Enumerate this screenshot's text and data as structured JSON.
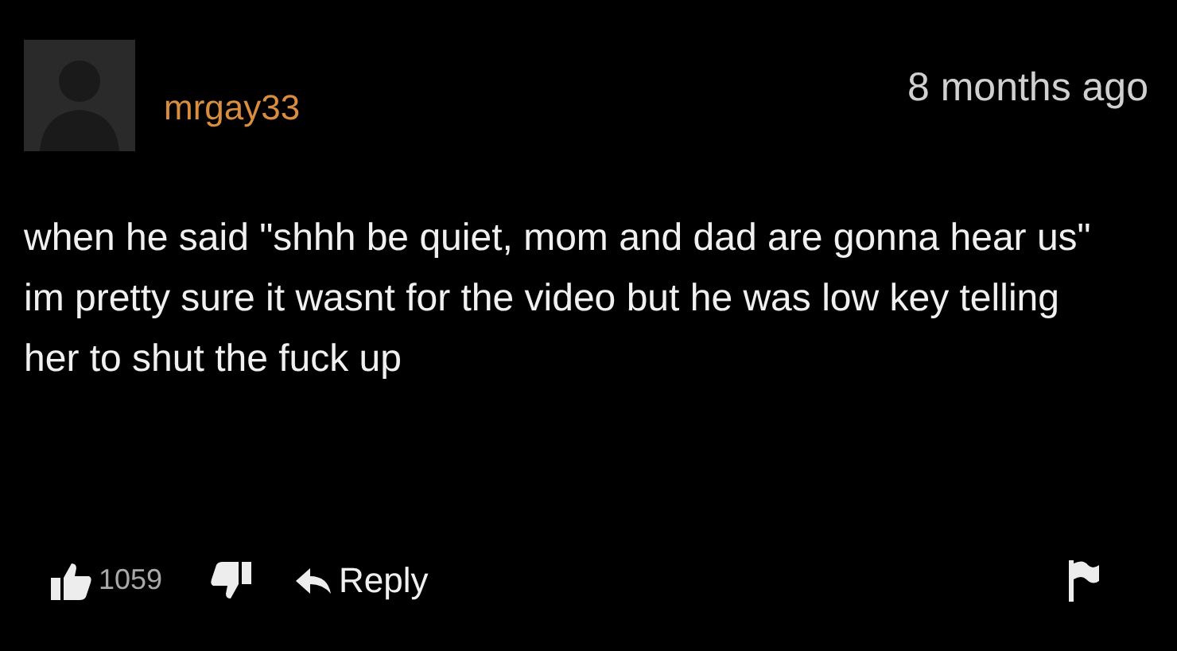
{
  "comment": {
    "username": "mrgay33",
    "time": "8 months ago",
    "text": "when he said \"shhh be quiet, mom and dad are gonna hear us\" im pretty sure it wasnt for the video but he was low key telling her to shut the fuck up",
    "likes": "1059",
    "reply": "Reply"
  }
}
